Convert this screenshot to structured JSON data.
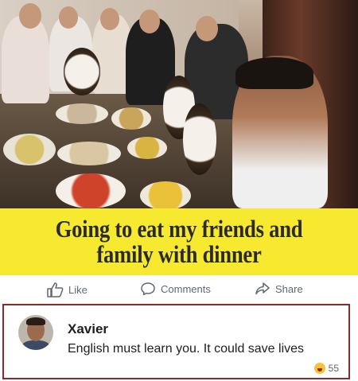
{
  "post": {
    "caption_line1": "Going to eat my friends and",
    "caption_line2": "family with dinner"
  },
  "actions": {
    "like_label": "Like",
    "comments_label": "Comments",
    "share_label": "Share"
  },
  "comment": {
    "author": "Xavier",
    "text": "English must learn you. It could save lives",
    "reaction_count": "55"
  },
  "colors": {
    "caption_bg": "#f6e92f",
    "comment_border": "#8b2a2a",
    "action_text": "#606770"
  }
}
